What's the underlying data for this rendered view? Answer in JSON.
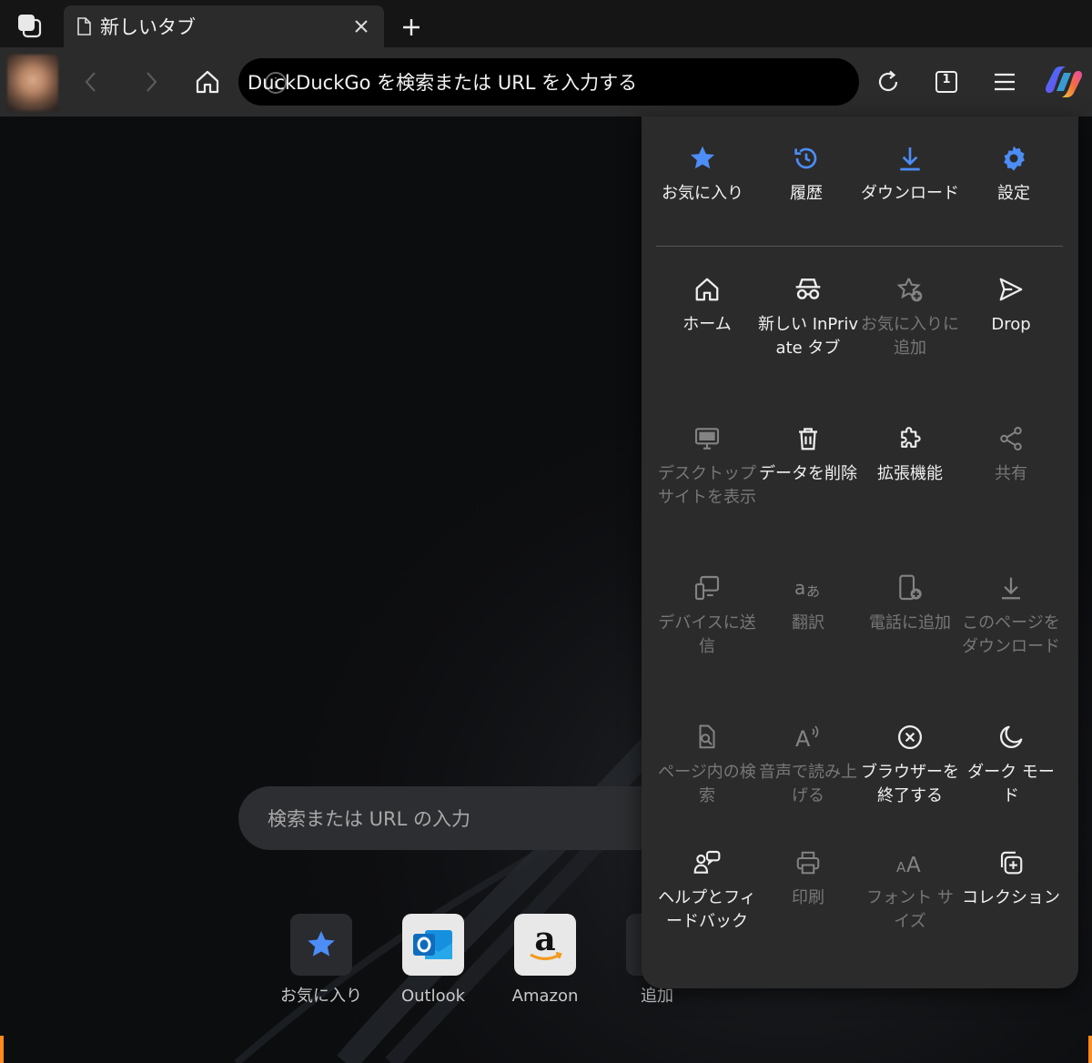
{
  "tab": {
    "title": "新しいタブ"
  },
  "address_bar": {
    "text": "DuckDuckGo を検索または URL を入力する"
  },
  "tab_count": "1",
  "new_tab_page": {
    "search_placeholder": "検索または URL の入力",
    "quick_links": [
      {
        "label": "お気に入り"
      },
      {
        "label": "Outlook"
      },
      {
        "label": "Amazon"
      },
      {
        "label": "追加"
      }
    ]
  },
  "menu": {
    "top": [
      {
        "label": "お気に入り",
        "icon": "star-icon"
      },
      {
        "label": "履歴",
        "icon": "history-icon"
      },
      {
        "label": "ダウンロード",
        "icon": "download-icon"
      },
      {
        "label": "設定",
        "icon": "gear-icon"
      }
    ],
    "grid": [
      {
        "label": "ホーム",
        "enabled": true
      },
      {
        "label": "新しい InPrivate タブ",
        "enabled": true
      },
      {
        "label": "お気に入りに追加",
        "enabled": false
      },
      {
        "label": "Drop",
        "enabled": true
      },
      {
        "label": "デスクトップ サイトを表示",
        "enabled": false
      },
      {
        "label": "データを削除",
        "enabled": true
      },
      {
        "label": "拡張機能",
        "enabled": true
      },
      {
        "label": "共有",
        "enabled": false
      },
      {
        "label": "デバイスに送信",
        "enabled": false
      },
      {
        "label": "翻訳",
        "enabled": false
      },
      {
        "label": "電話に追加",
        "enabled": false
      },
      {
        "label": "このページをダウンロード",
        "enabled": false
      },
      {
        "label": "ページ内の検索",
        "enabled": false
      },
      {
        "label": "音声で読み上げる",
        "enabled": false
      },
      {
        "label": "ブラウザーを終了する",
        "enabled": true
      },
      {
        "label": "ダーク モード",
        "enabled": true
      },
      {
        "label": "ヘルプとフィードバック",
        "enabled": true
      },
      {
        "label": "印刷",
        "enabled": false
      },
      {
        "label": "フォント サイズ",
        "enabled": false
      },
      {
        "label": "コレクション",
        "enabled": true
      }
    ]
  },
  "colors": {
    "accent": "#4c8df6",
    "menu_bg": "#2b2b2b",
    "toolbar_bg": "#2b2b2b"
  }
}
